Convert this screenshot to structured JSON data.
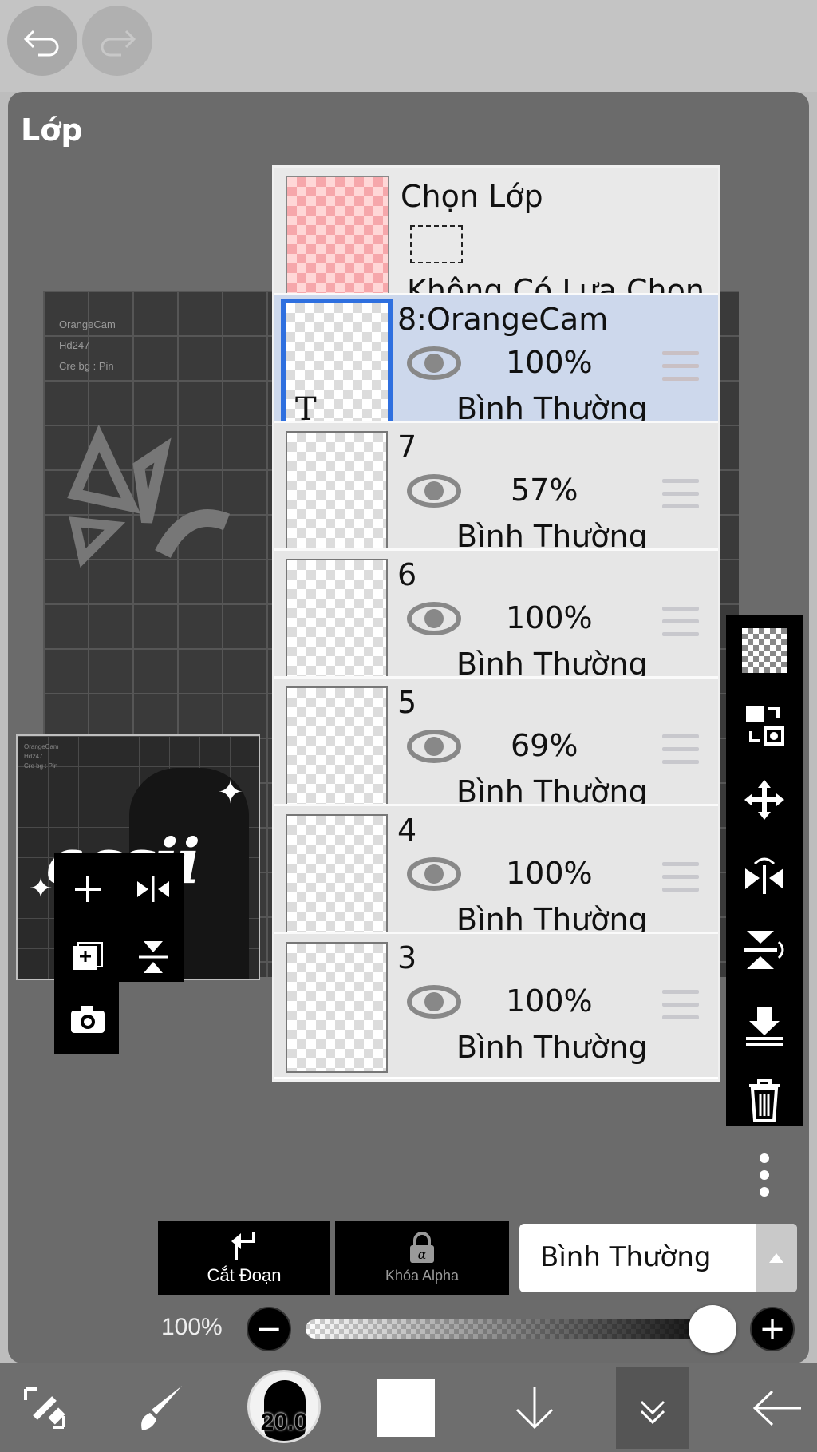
{
  "panel": {
    "title": "Lớp"
  },
  "canvas": {
    "credit_lines": [
      "OrangeCam",
      "Hd247",
      "Cre bg : Pin"
    ],
    "thumbnail_word": "acsii"
  },
  "selection_layer": {
    "title": "Chọn Lớp",
    "status": "Không Có Lựa Chọn"
  },
  "layers": [
    {
      "name": "8:OrangeCam",
      "opacity": "100%",
      "blend": "Bình Thường",
      "active": true,
      "type": "text"
    },
    {
      "name": "7",
      "opacity": "57%",
      "blend": "Bình Thường",
      "active": false
    },
    {
      "name": "6",
      "opacity": "100%",
      "blend": "Bình Thường",
      "active": false
    },
    {
      "name": "5",
      "opacity": "69%",
      "blend": "Bình Thường",
      "active": false
    },
    {
      "name": "4",
      "opacity": "100%",
      "blend": "Bình Thường",
      "active": false
    },
    {
      "name": "3",
      "opacity": "100%",
      "blend": "Bình Thường",
      "active": false
    }
  ],
  "controls": {
    "clipping_label": "Cắt Đoạn",
    "alpha_lock_label": "Khóa Alpha",
    "blend_mode": "Bình Thường",
    "opacity_label": "100%",
    "opacity_value": 1.0
  },
  "bottom": {
    "brush_size": "20.0",
    "color": "#ffffff"
  },
  "icons": {
    "top": [
      "undo-icon",
      "redo-icon"
    ],
    "left_tools": [
      "add-layer-icon",
      "flip-horizontal-icon",
      "add-layer-copy-icon",
      "flip-vertical-icon",
      "camera-icon"
    ],
    "right_tools": [
      "transparency-icon",
      "layer-convert-icon",
      "move-icon",
      "flip-horizontal-icon",
      "flip-vertical-icon",
      "merge-down-icon",
      "trash-icon",
      "more-icon"
    ],
    "bottom": [
      "transform-icon",
      "brush-icon",
      "brush-size-icon",
      "color-icon",
      "arrow-down-icon",
      "panel-toggle-icon",
      "back-icon"
    ]
  },
  "colors": {
    "active_layer_bg": "#cdd8ec",
    "active_border": "#2e6fdf",
    "panel_bg": "#6b6b6b"
  }
}
